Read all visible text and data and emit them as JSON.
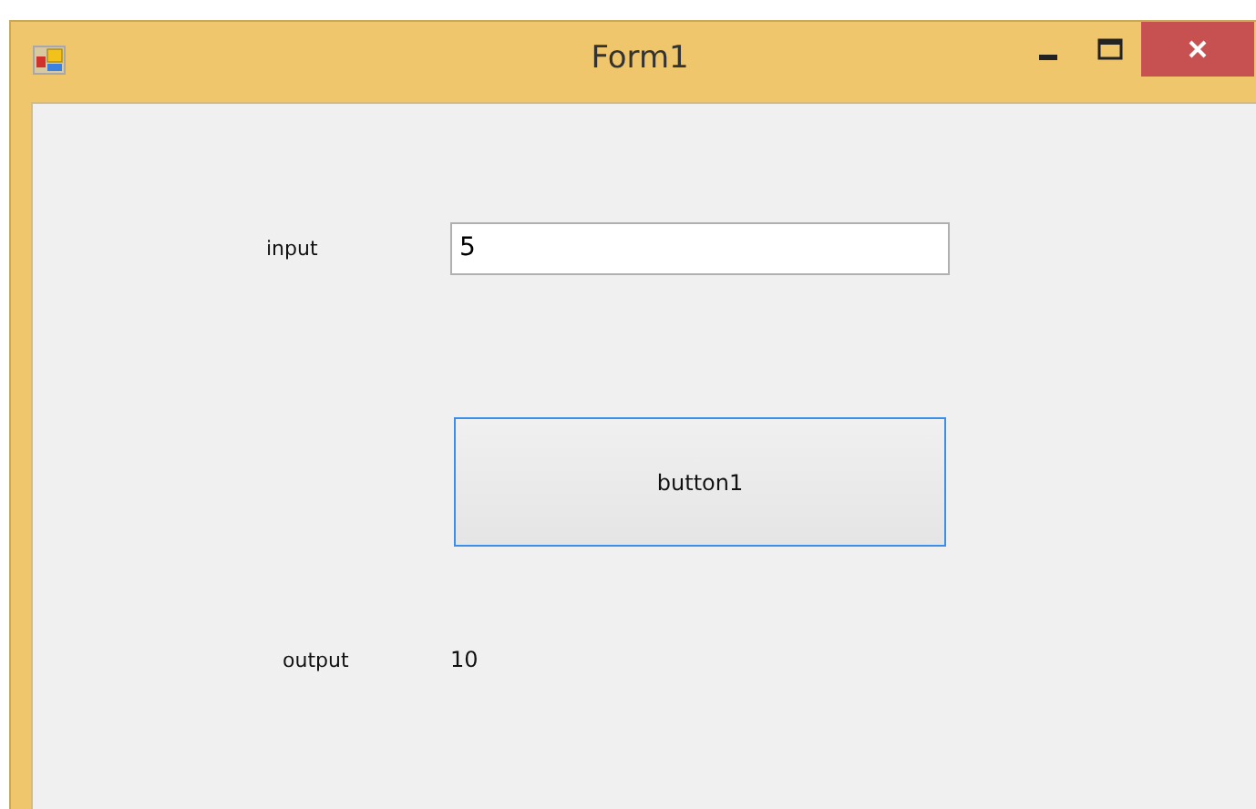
{
  "window": {
    "title": "Form1"
  },
  "input": {
    "label": "input",
    "value": "5"
  },
  "button": {
    "label": "button1",
    "focused": true
  },
  "output": {
    "label": "output",
    "value": "10"
  }
}
